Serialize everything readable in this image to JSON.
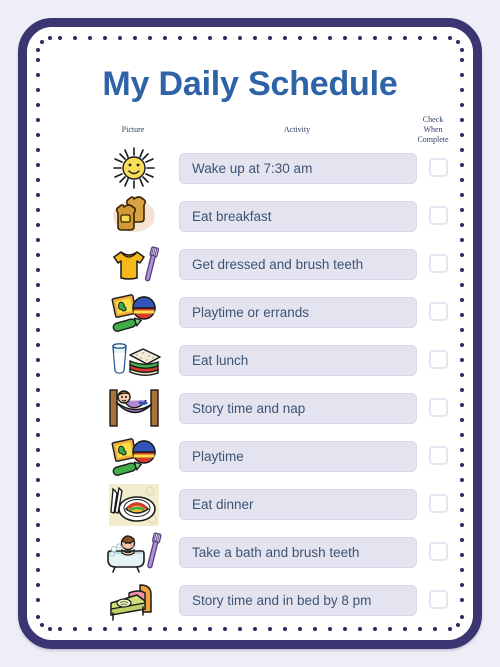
{
  "page": {
    "title": "My Daily Schedule",
    "frame_color": "#3b3672",
    "title_color": "#2f63a8",
    "background_color": "#eeeef6",
    "card_color": "#ffffff",
    "pill_color": "#e4e4f1",
    "pill_text_color": "#3d5372"
  },
  "headers": {
    "picture": "Picture",
    "activity": "Activity",
    "check_line1": "Check",
    "check_line2": "When",
    "check_line3": "Complete"
  },
  "rows": [
    {
      "icon": "sun-icon",
      "activity": "Wake up at 7:30 am",
      "checked": false
    },
    {
      "icon": "toast-icon",
      "activity": "Eat breakfast",
      "checked": false
    },
    {
      "icon": "shirt-toothbrush-icon",
      "activity": "Get dressed and brush teeth",
      "checked": false
    },
    {
      "icon": "toys-icon",
      "activity": "Playtime or errands",
      "checked": false
    },
    {
      "icon": "sandwich-milk-icon",
      "activity": "Eat lunch",
      "checked": false
    },
    {
      "icon": "hammock-icon",
      "activity": "Story time and nap",
      "checked": false
    },
    {
      "icon": "toys-icon",
      "activity": "Playtime",
      "checked": false
    },
    {
      "icon": "dinner-plate-icon",
      "activity": "Eat dinner",
      "checked": false
    },
    {
      "icon": "bathtub-toothbrush-icon",
      "activity": "Take a bath and brush teeth",
      "checked": false
    },
    {
      "icon": "bed-icon",
      "activity": "Story time and in bed by 8 pm",
      "checked": false
    }
  ]
}
